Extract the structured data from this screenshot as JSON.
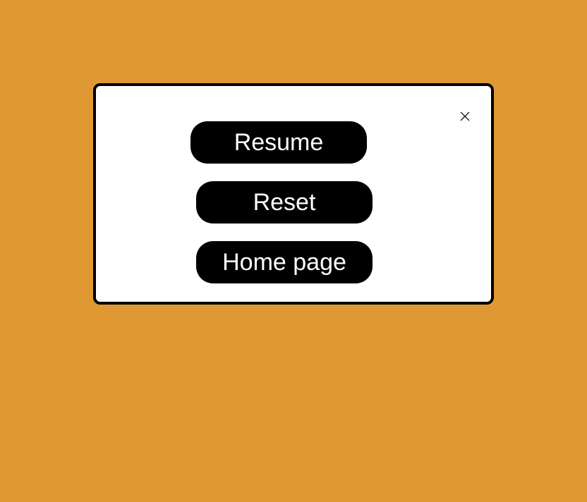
{
  "page": {
    "background_color": "#e09932"
  },
  "modal": {
    "close_icon": "close-icon",
    "buttons": {
      "resume_label": "Resume",
      "reset_label": "Reset",
      "home_label": "Home page"
    },
    "button_color": "#000000",
    "button_text_color": "#ffffff"
  }
}
